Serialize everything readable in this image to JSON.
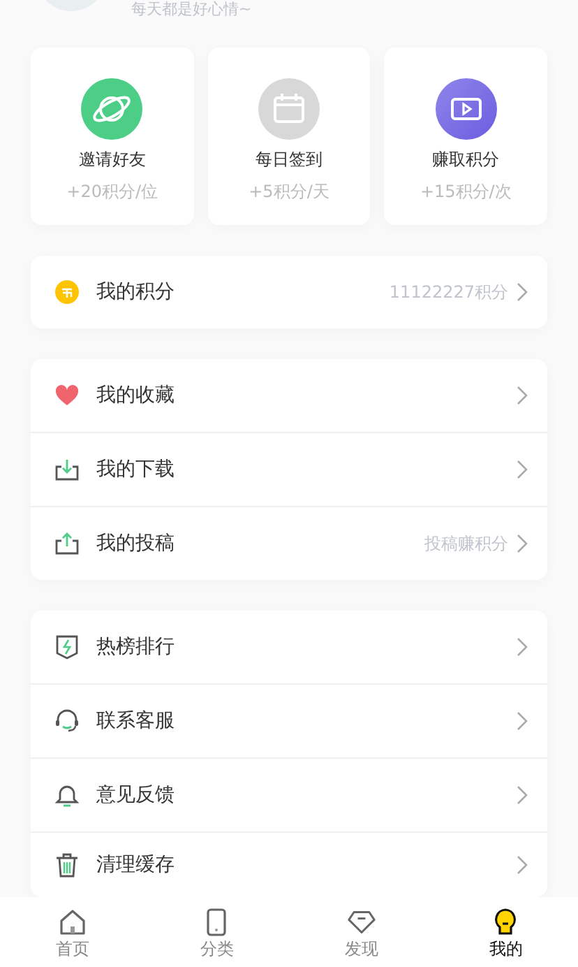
{
  "profile": {
    "motto": "每天都是好心情~"
  },
  "quick_actions": [
    {
      "kind": "planet",
      "title": "邀请好友",
      "reward": "+20积分/位"
    },
    {
      "kind": "calendar",
      "title": "每日签到",
      "reward": "+5积分/天"
    },
    {
      "kind": "video",
      "title": "赚取积分",
      "reward": "+15积分/次"
    }
  ],
  "menu_groups": [
    [
      {
        "kind": "coin",
        "label": "我的积分",
        "value": "11122227积分"
      }
    ],
    [
      {
        "kind": "heart",
        "label": "我的收藏"
      },
      {
        "kind": "download",
        "label": "我的下载"
      },
      {
        "kind": "upload",
        "label": "我的投稿",
        "value": "投稿赚积分"
      }
    ],
    [
      {
        "kind": "shield",
        "label": "热榜排行"
      },
      {
        "kind": "headset",
        "label": "联系客服"
      },
      {
        "kind": "bell",
        "label": "意见反馈"
      },
      {
        "kind": "trash",
        "label": "清理缓存"
      }
    ]
  ],
  "tab_bar": [
    {
      "kind": "home",
      "label": "首页",
      "selected": false
    },
    {
      "kind": "tablet",
      "label": "分类",
      "selected": false
    },
    {
      "kind": "gem",
      "label": "发现",
      "selected": false
    },
    {
      "kind": "bulb",
      "label": "我的",
      "selected": true
    }
  ]
}
